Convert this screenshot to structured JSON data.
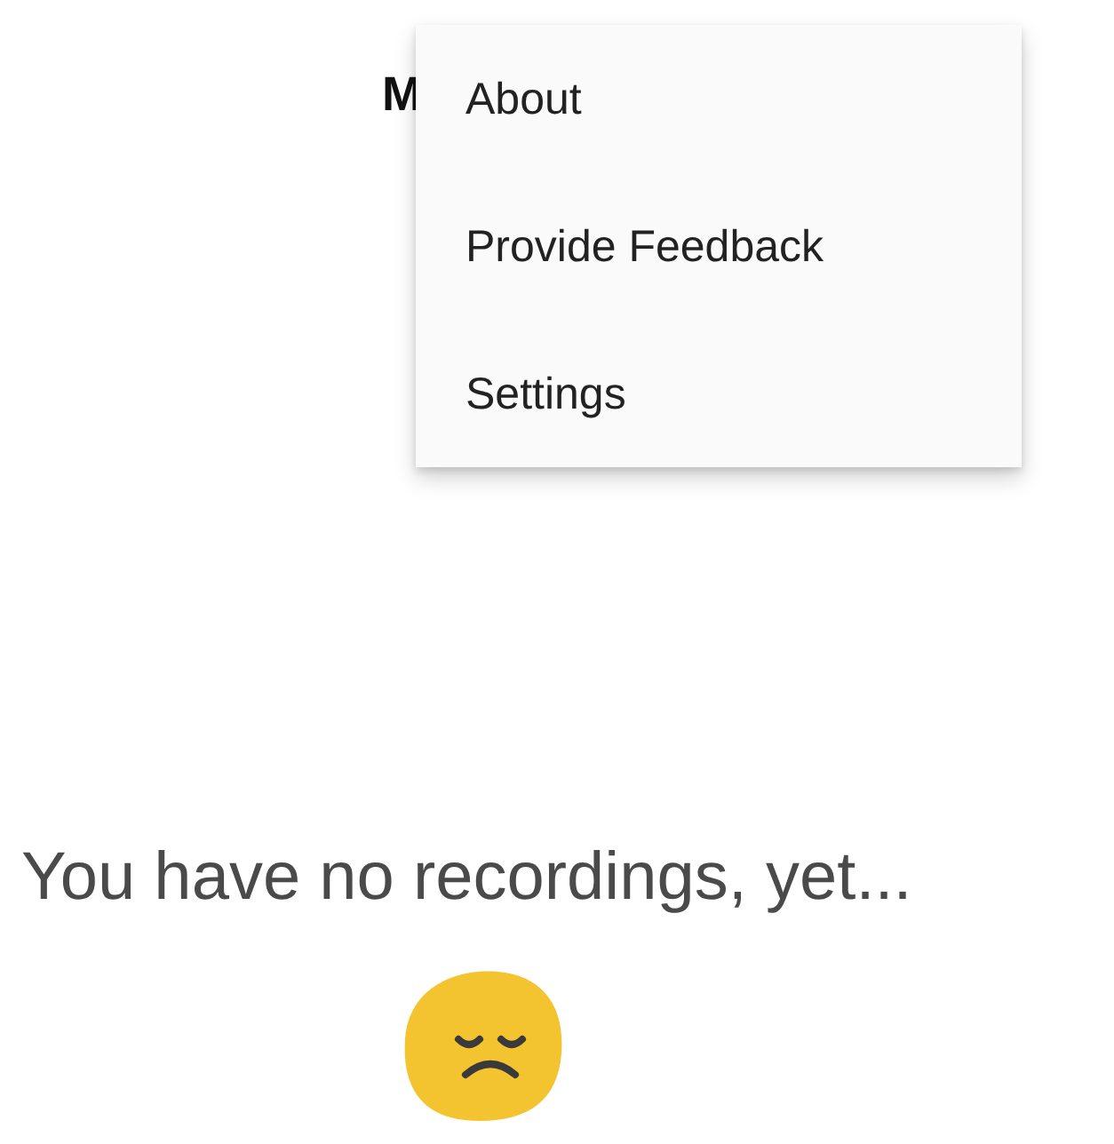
{
  "toolbar": {
    "title": "M"
  },
  "menu": {
    "items": [
      {
        "label": "About"
      },
      {
        "label": "Provide Feedback"
      },
      {
        "label": "Settings"
      }
    ]
  },
  "empty_state": {
    "message": "You have no recordings, yet..."
  }
}
